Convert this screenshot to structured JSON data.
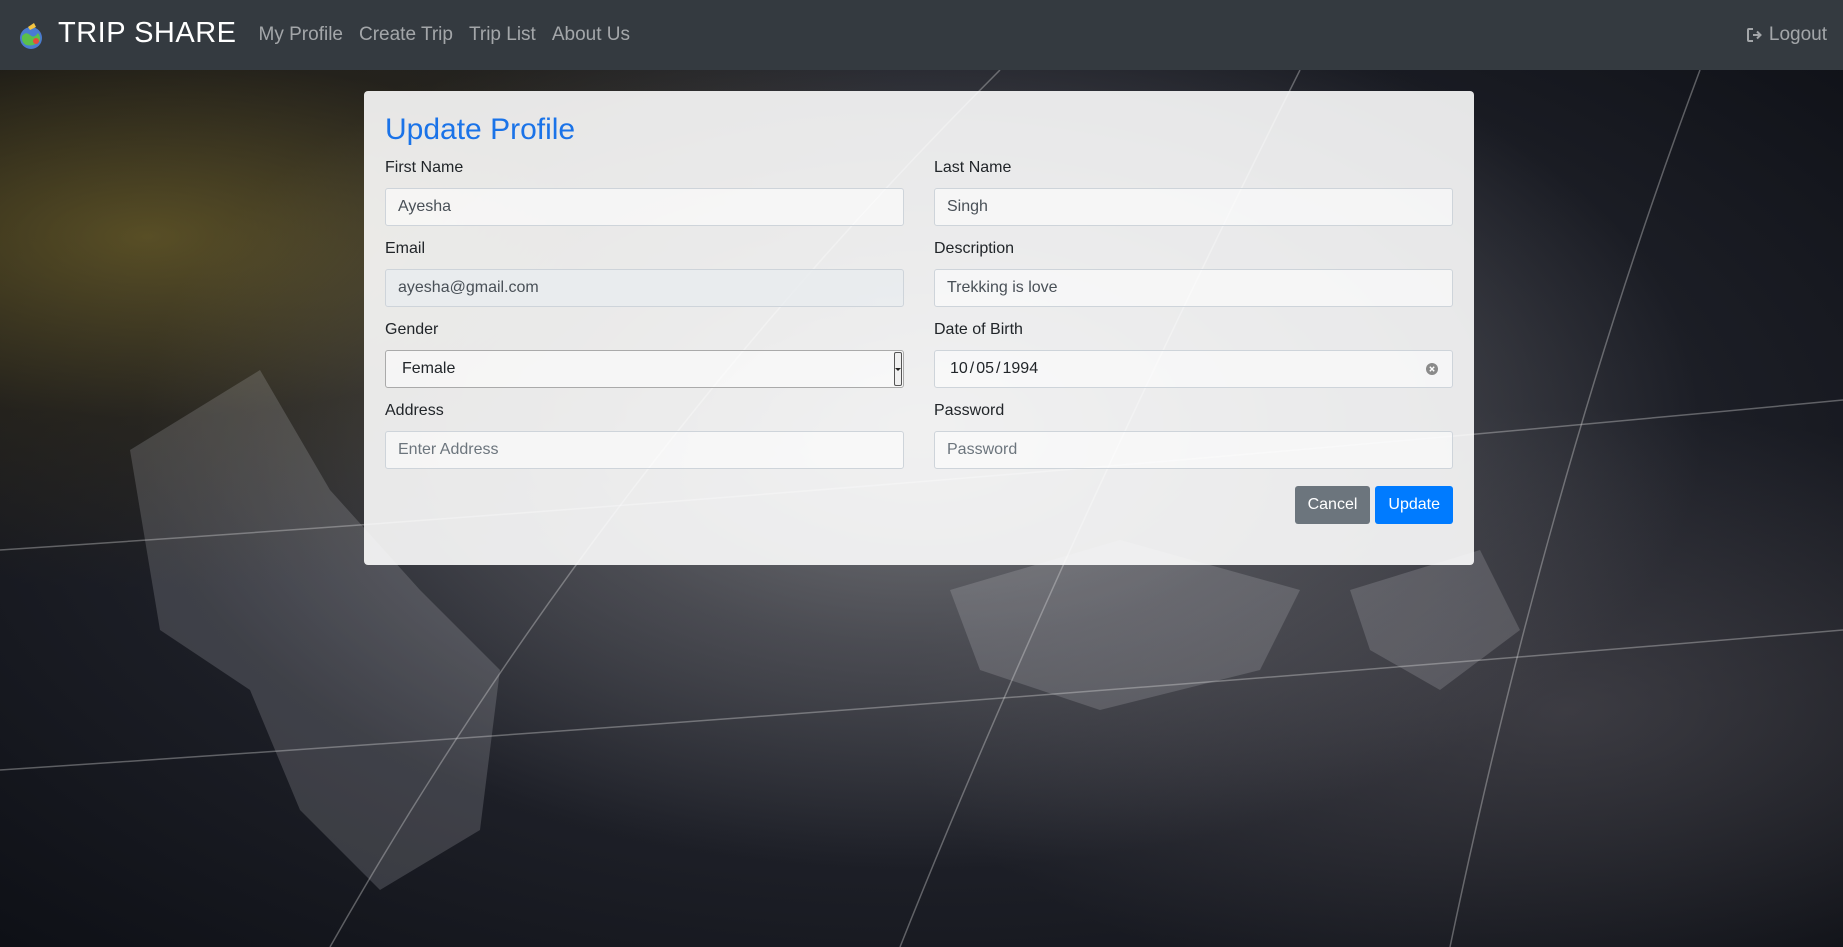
{
  "navbar": {
    "brand": "TRIP SHARE",
    "links": [
      "My Profile",
      "Create Trip",
      "Trip List",
      "About Us"
    ],
    "logout": "Logout"
  },
  "form": {
    "title": "Update Profile",
    "first_name": {
      "label": "First Name",
      "value": "Ayesha"
    },
    "last_name": {
      "label": "Last Name",
      "value": "Singh"
    },
    "email": {
      "label": "Email",
      "value": "ayesha@gmail.com"
    },
    "description": {
      "label": "Description",
      "value": "Trekking is love"
    },
    "gender": {
      "label": "Gender",
      "value": "Female"
    },
    "dob": {
      "label": "Date of Birth",
      "month": "10",
      "day": "05",
      "year": "1994"
    },
    "address": {
      "label": "Address",
      "placeholder": "Enter Address"
    },
    "password": {
      "label": "Password",
      "placeholder": "Password"
    },
    "cancel_label": "Cancel",
    "update_label": "Update"
  },
  "colors": {
    "navbar": "#343a40",
    "title": "#1a73e8",
    "primary": "#007bff",
    "secondary": "#6c757d"
  }
}
